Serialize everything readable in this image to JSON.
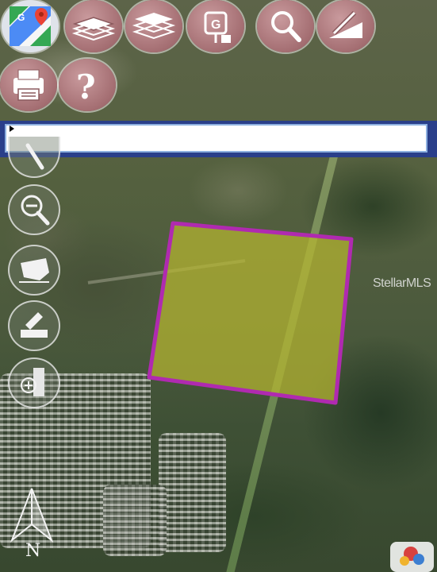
{
  "map": {
    "watermark_text": "StellarMLS",
    "parcel": {
      "fill": "#b5b531",
      "stroke": "#b02ab0"
    },
    "north_label": "N"
  },
  "toolbar": {
    "items": [
      {
        "icon": "google-maps-icon"
      },
      {
        "icon": "layers-icon"
      },
      {
        "icon": "layers-alt-icon"
      },
      {
        "icon": "street-view-icon"
      },
      {
        "icon": "search-icon"
      },
      {
        "icon": "draw-icon"
      },
      {
        "icon": "print-icon"
      },
      {
        "icon": "help-icon"
      }
    ],
    "button_color": "#b07b7e"
  },
  "search": {
    "value": "",
    "placeholder": ""
  },
  "side_controls": {
    "items": [
      {
        "icon": "zoom-in-icon"
      },
      {
        "icon": "zoom-out-icon"
      },
      {
        "icon": "territory-icon"
      },
      {
        "icon": "measure-icon"
      },
      {
        "icon": "street-view-person-icon"
      }
    ]
  },
  "colors": {
    "accent_bar": "#2a3f8a",
    "search_border": "#8db0e0"
  }
}
